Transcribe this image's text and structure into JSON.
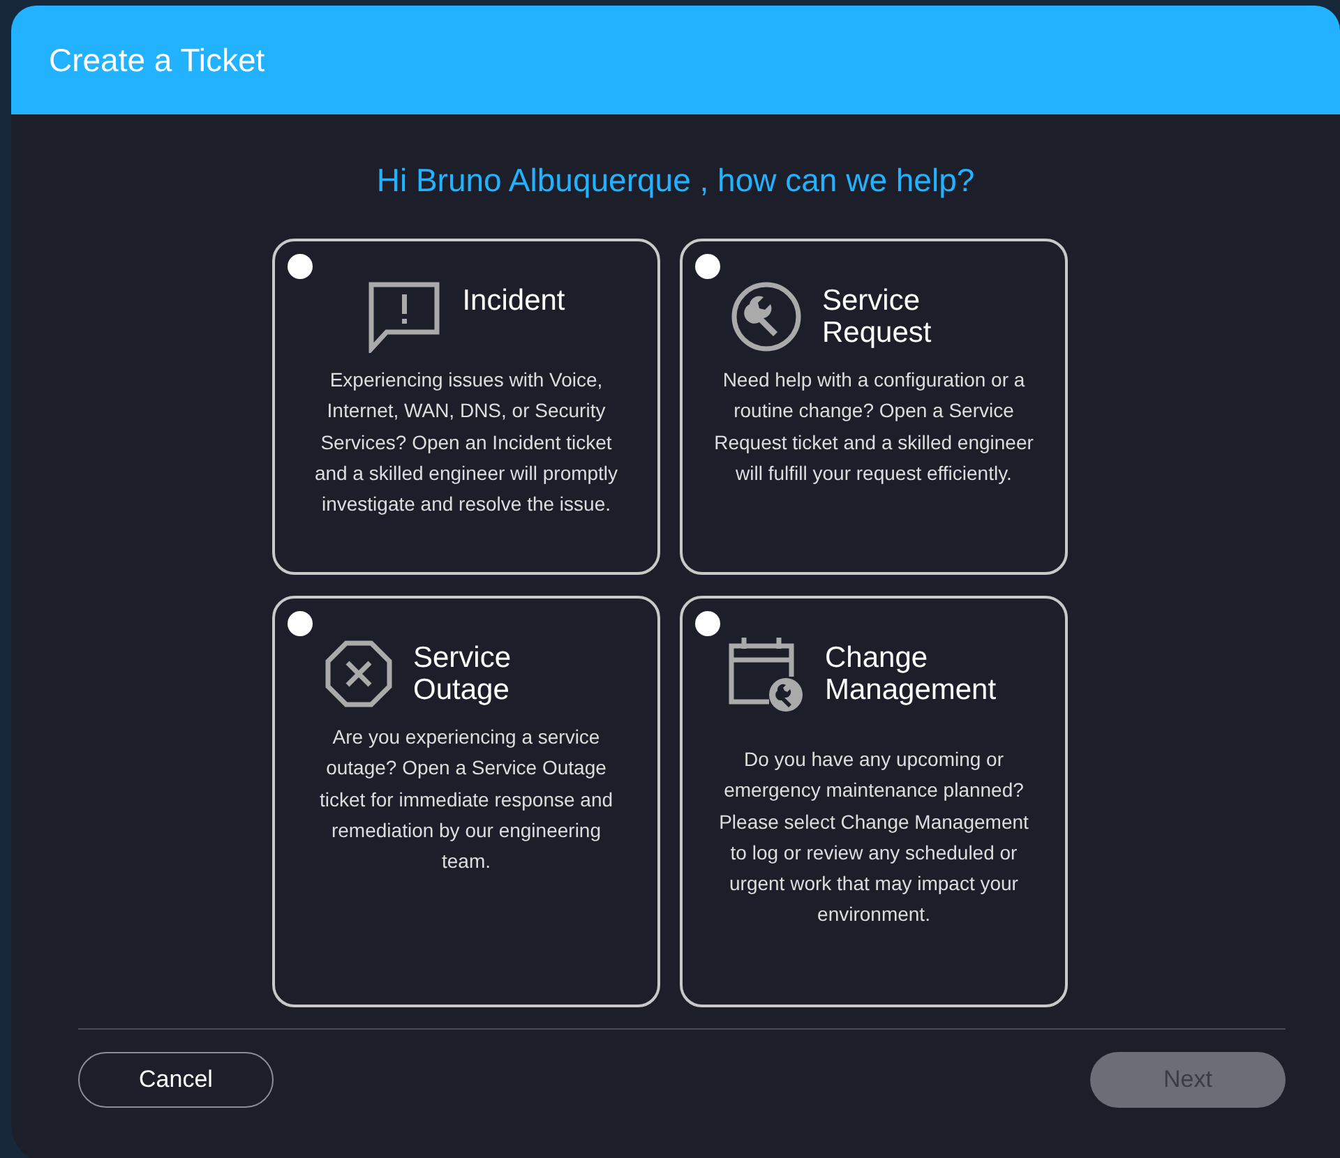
{
  "window": {
    "title": "Create a Ticket"
  },
  "greeting": "Hi Bruno Albuquerque , how can we help?",
  "options": [
    {
      "kind": "incident",
      "title": "Incident",
      "description": "Experiencing issues with Voice, Internet, WAN, DNS, or Security Services? Open an Incident ticket and a skilled engineer will promptly investigate and resolve the issue.",
      "selected": false
    },
    {
      "kind": "request",
      "title": "Service Request",
      "description": "Need help with a configuration or a routine change? Open a Service Request ticket and a skilled engineer will fulfill your request efficiently.",
      "selected": false
    },
    {
      "kind": "outage",
      "title": "Service Outage",
      "description": "Are you experiencing a service outage? Open a Service Outage ticket for immediate response and remediation by our engineering team.",
      "selected": false
    },
    {
      "kind": "change",
      "title": "Change Management",
      "description": "Do you have any upcoming or emergency maintenance planned? Please select Change Management to log or review any scheduled or urgent work that may impact your environment.",
      "selected": false
    }
  ],
  "buttons": {
    "cancel": {
      "label": "Cancel"
    },
    "next": {
      "label": "Next",
      "disabled": true
    }
  }
}
